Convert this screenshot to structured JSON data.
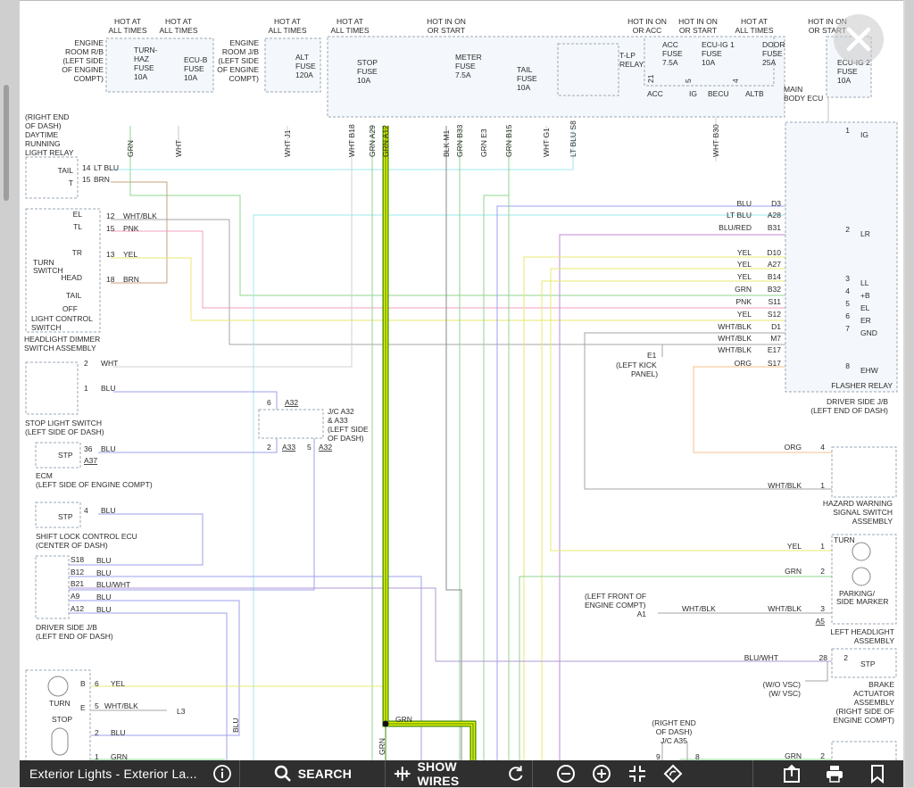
{
  "toolbar": {
    "title": "Exterior Lights - Exterior La...",
    "search_label": "SEARCH",
    "show_wires_label": "SHOW WIRES",
    "icons": [
      "info-icon",
      "search-icon",
      "wire-icon",
      "refresh-icon",
      "zoom-out-icon",
      "zoom-in-icon",
      "fit-icon",
      "rotate-icon",
      "export-icon",
      "print-icon",
      "bookmark-icon"
    ]
  },
  "colors": {
    "highlight": "#e8f000",
    "highlight_edge": "#3a8a00",
    "toolbar_bg": "#2f2f2f"
  },
  "fuses": {
    "turn_haz": {
      "supply": [
        "HOT AT",
        "ALL TIMES"
      ],
      "name": [
        "TURN-",
        "HAZ",
        "FUSE",
        "10A"
      ]
    },
    "ecu_b": {
      "supply": [
        "HOT AT",
        "ALL TIMES"
      ],
      "name": [
        "ECU-B",
        "FUSE",
        "10A"
      ]
    },
    "engine_room_rb": [
      "ENGINE",
      "ROOM R/B",
      "(LEFT SIDE",
      "OF ENGINE",
      "COMPT)"
    ],
    "alt": {
      "supply": [
        "HOT AT",
        "ALL TIMES"
      ],
      "name": [
        "ALT",
        "FUSE",
        "120A"
      ]
    },
    "engine_room_jb": [
      "ENGINE",
      "ROOM J/B",
      "(LEFT SIDE",
      "OF ENGINE",
      "COMPT)"
    ],
    "stop": {
      "supply": [
        "HOT AT",
        "ALL TIMES"
      ],
      "name": [
        "STOP",
        "FUSE",
        "10A"
      ]
    },
    "meter": {
      "supply": [
        "HOT IN ON",
        "OR START"
      ],
      "name": [
        "METER",
        "FUSE",
        "7.5A"
      ]
    },
    "tail": {
      "name": [
        "TAIL",
        "FUSE",
        "10A"
      ]
    },
    "tlp_relay": [
      "T-LP",
      "RELAY"
    ],
    "acc": {
      "supply": [
        "HOT IN ON",
        "OR ACC"
      ],
      "name": [
        "ACC",
        "FUSE",
        "7.5A"
      ]
    },
    "ecu_ig1": {
      "supply": [
        "HOT IN ON",
        "OR START"
      ],
      "name": [
        "ECU-IG 1",
        "FUSE",
        "10A"
      ]
    },
    "door": {
      "supply": [
        "HOT AT",
        "ALL TIMES"
      ],
      "name": [
        "DOOR",
        "FUSE",
        "25A"
      ]
    },
    "ecu_ig2": {
      "supply": [
        "HOT IN ON",
        "OR START"
      ],
      "name": [
        "ECU-IG 2",
        "FUSE",
        "10A"
      ]
    },
    "main_body": [
      "MAIN",
      "BODY ECU"
    ],
    "main_body_pins": [
      "ACC",
      "IG",
      "BECU",
      "ALTB"
    ],
    "main_body_nums": [
      "21",
      "5",
      "4"
    ]
  },
  "top_wires": [
    {
      "label": "GRN"
    },
    {
      "label": "WHT"
    },
    {
      "label": "WHT",
      "pin": "J1"
    },
    {
      "label": "WHT",
      "pin": "B18"
    },
    {
      "label": "GRN",
      "pin": "A29"
    },
    {
      "label": "GRN",
      "pin": "A12"
    },
    {
      "label": "BLK",
      "pin": "M1"
    },
    {
      "label": "GRN",
      "pin": "B33"
    },
    {
      "label": "GRN",
      "pin": "E3"
    },
    {
      "label": "GRN",
      "pin": "B15"
    },
    {
      "label": "WHT",
      "pin": "G1"
    },
    {
      "label": "LT BLU",
      "pin": "S8"
    },
    {
      "label": "WHT",
      "pin": "B30"
    }
  ],
  "daytime_relay": {
    "label": [
      "(RIGHT END",
      "OF DASH)",
      "DAYTIME",
      "RUNNING",
      "LIGHT RELAY"
    ],
    "pins": [
      {
        "name": "TAIL",
        "num": "14",
        "wire": "LT BLU"
      },
      {
        "name": "T",
        "num": "15",
        "wire": "BRN"
      }
    ]
  },
  "light_switch": {
    "pins": [
      {
        "name": "EL",
        "num": "12",
        "wire": "WHT/BLK"
      },
      {
        "name": "TL",
        "num": "15",
        "wire": "PNK"
      },
      {
        "name": "TR",
        "num": "13",
        "wire": "YEL"
      },
      {
        "name": "HEAD",
        "num": "18",
        "wire": "BRN"
      }
    ],
    "labels": [
      "TURN",
      "SWITCH",
      "TAIL",
      "OFF",
      "LIGHT CONTROL",
      "SWITCH"
    ],
    "assembly": [
      "HEADLIGHT DIMMER",
      "SWITCH ASSEMBLY"
    ]
  },
  "stop_light_switch": {
    "pins": [
      {
        "num": "2",
        "wire": "WHT"
      },
      {
        "num": "1",
        "wire": "BLU"
      }
    ],
    "label": [
      "STOP LIGHT SWITCH",
      "(LEFT SIDE OF DASH)"
    ]
  },
  "jc": {
    "label": [
      "J/C A32",
      "& A33",
      "(LEFT SIDE",
      "OF DASH)"
    ],
    "pins": [
      "6",
      "A32",
      "2",
      "A33",
      "5",
      "A32"
    ]
  },
  "ecm": {
    "pin": "36",
    "wire": "BLU",
    "conn": "A37",
    "name": "STP",
    "label": [
      "ECM",
      "(LEFT SIDE OF ENGINE COMPT)"
    ]
  },
  "shift_lock": {
    "pin": "4",
    "wire": "BLU",
    "name": "STP",
    "label": [
      "SHIFT LOCK CONTROL ECU",
      "(CENTER OF DASH)"
    ]
  },
  "driver_jb_left": {
    "pins": [
      {
        "name": "S18",
        "wire": "BLU"
      },
      {
        "name": "B12",
        "wire": "BLU"
      },
      {
        "name": "B21",
        "wire": "BLU/WHT"
      },
      {
        "name": "A9",
        "wire": "BLU"
      },
      {
        "name": "A12",
        "wire": "BLU"
      }
    ],
    "label": [
      "DRIVER SIDE J/B",
      "(LEFT END OF DASH)"
    ]
  },
  "turn_lamp": {
    "pins": [
      {
        "name": "B",
        "num": "6",
        "wire": "YEL"
      },
      {
        "name": "E",
        "num": "5",
        "wire": "WHT/BLK"
      },
      {
        "num": "2",
        "wire": "BLU"
      },
      {
        "num": "1",
        "wire": "GRN"
      }
    ],
    "labels": [
      "TURN",
      "STOP"
    ],
    "ground": "L3",
    "vert_wire": "BLU"
  },
  "driver_jb_right": {
    "rows": [
      {
        "wire": "BLU",
        "pin": "D3"
      },
      {
        "wire": "LT BLU",
        "pin": "A28"
      },
      {
        "wire": "BLU/RED",
        "pin": "B31"
      },
      {
        "wire": "YEL",
        "pin": "D10"
      },
      {
        "wire": "YEL",
        "pin": "A27"
      },
      {
        "wire": "YEL",
        "pin": "B14"
      },
      {
        "wire": "GRN",
        "pin": "B32"
      },
      {
        "wire": "PNK",
        "pin": "S11"
      },
      {
        "wire": "YEL",
        "pin": "S12"
      },
      {
        "wire": "WHT/BLK",
        "pin": "D1"
      },
      {
        "wire": "WHT/BLK",
        "pin": "M7"
      },
      {
        "wire": "WHT/BLK",
        "pin": "E17"
      },
      {
        "wire": "ORG",
        "pin": "S17"
      }
    ],
    "ground": [
      "E1",
      "(LEFT KICK",
      "PANEL)"
    ],
    "label": [
      "DRIVER SIDE J/B",
      "(LEFT END OF DASH)"
    ]
  },
  "flasher": {
    "pins": [
      {
        "num": "1",
        "name": "IG"
      },
      {
        "num": "2",
        "name": "LR"
      },
      {
        "num": "3",
        "name": "LL"
      },
      {
        "num": "4",
        "name": "+B"
      },
      {
        "num": "5",
        "name": "EL"
      },
      {
        "num": "6",
        "name": "ER"
      },
      {
        "num": "7",
        "name": "GND"
      },
      {
        "num": "8",
        "name": "EHW"
      }
    ],
    "label": "FLASHER RELAY"
  },
  "hazard": {
    "pins": [
      {
        "num": "4",
        "wire": "ORG"
      },
      {
        "num": "1",
        "wire": "WHT/BLK"
      }
    ],
    "label": [
      "HAZARD WARNING",
      "SIGNAL SWITCH",
      "ASSEMBLY"
    ]
  },
  "left_headlight": {
    "pins": [
      {
        "num": "1",
        "wire": "YEL"
      },
      {
        "num": "2",
        "wire": "GRN"
      },
      {
        "num": "3",
        "wire": "WHT/BLK"
      }
    ],
    "names": [
      "TURN",
      "PARKING/",
      "SIDE MARKER"
    ],
    "conn": "A5",
    "ground": {
      "name": "A1",
      "wire": "WHT/BLK",
      "label": [
        "(LEFT FRONT OF",
        "ENGINE COMPT)"
      ]
    },
    "label": [
      "LEFT HEADLIGHT",
      "ASSEMBLY"
    ]
  },
  "brake": {
    "pin": "28",
    "num": "2",
    "wire": "BLU/WHT",
    "name": "STP",
    "variants": [
      "(W/O VSC)",
      "(W/ VSC)"
    ],
    "label": [
      "BRAKE",
      "ACTUATOR",
      "ASSEMBLY",
      "(RIGHT SIDE OF",
      "ENGINE COMPT)"
    ]
  },
  "bottom": {
    "grn_label": "GRN",
    "vert": "GRN",
    "jc35": [
      "(RIGHT END",
      "OF DASH)",
      "J/C A35"
    ],
    "jc35_pins": [
      "9",
      "8"
    ],
    "right_wire": "GRN",
    "right_pin": "2"
  }
}
